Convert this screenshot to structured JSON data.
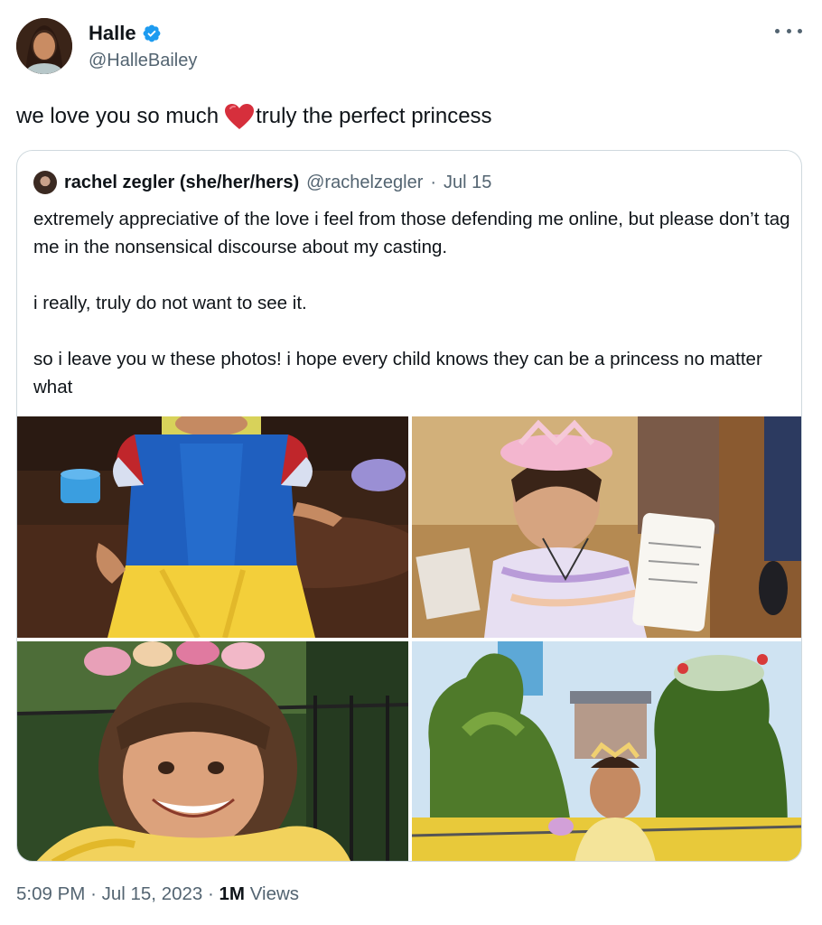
{
  "author": {
    "display_name": "Halle",
    "handle": "@HalleBailey",
    "verified": true,
    "avatar_icon": "profile-photo"
  },
  "tweet": {
    "text_before": "we love you so much",
    "emoji": "red-heart",
    "text_after": "truly the perfect princess"
  },
  "quoted_tweet": {
    "display_name": "rachel zegler (she/her/hers)",
    "handle": "@rachelzegler",
    "separator": "·",
    "date": "Jul 15",
    "paragraphs": [
      "extremely appreciative of the love i feel from those defending me online, but please don’t tag me in the nonsensical discourse about my casting.",
      "i really, truly do not want to see it.",
      "so i leave you w these photos! i hope every child knows they can be a princess no matter what"
    ],
    "photos": [
      "child-in-snow-white-costume",
      "child-with-tiara-holding-paper",
      "child-in-flower-crown-smiling",
      "child-in-front-of-topiary"
    ]
  },
  "meta": {
    "time": "5:09 PM",
    "sep1": "·",
    "date": "Jul 15, 2023",
    "sep2": "·",
    "views_count": "1M",
    "views_label": "Views"
  },
  "colors": {
    "text": "#0f1419",
    "secondary": "#536471",
    "verified": "#1d9bf0",
    "border": "#cfd9de",
    "heart": "#e0245e"
  }
}
